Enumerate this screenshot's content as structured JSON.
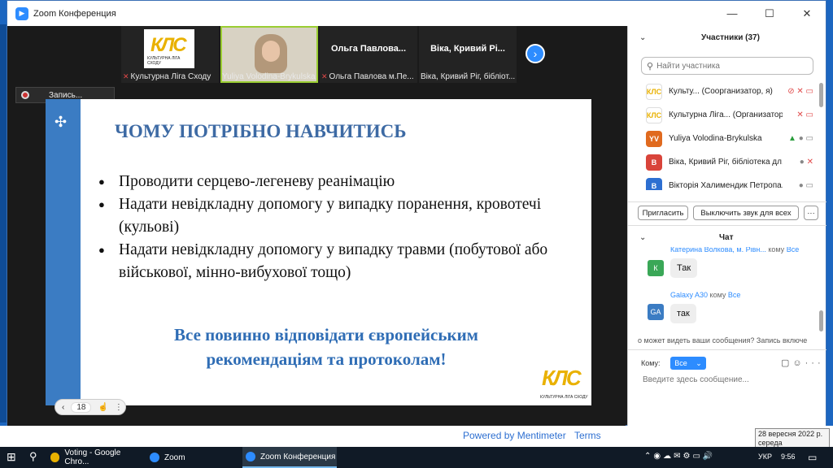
{
  "window": {
    "title": "Zoom Конференция",
    "minimize": "—",
    "maximize": "☐",
    "close": "✕"
  },
  "thumbnails": [
    {
      "label": "Культурна Ліга Сходу",
      "logo_text": "КЛС",
      "logo_sub": "КУЛЬТУРНА ЛІГА СХОДУ",
      "mic": "muted"
    },
    {
      "label": "Yuliya Volodina-Brykulska",
      "has_video": true
    },
    {
      "label": "Ольга Павлова м.Пе...",
      "big_name": "Ольга Павлова...",
      "mic": "muted"
    },
    {
      "label": "Віка, Кривий Ріг, бібліот...",
      "big_name": "Віка, Кривий Рі..."
    }
  ],
  "recording": {
    "label": "Запись..."
  },
  "slide": {
    "title": "ЧОМУ ПОТРІБНО НАВЧИТИСЬ",
    "bullets": [
      "Проводити серцево-легеневу реанімацію",
      "Надати невідкладну допомогу у випадку поранення, кровотечі (кульові)",
      "Надати невідкладну допомогу у випадку травми (побутової або військової, мінно-вибухової тощо)"
    ],
    "footer_line1": "Все повинно відповідати європейським",
    "footer_line2": "рекомендаціям та протоколам!",
    "logo_text": "КЛС",
    "logo_sub": "КУЛЬТУРНА ЛІГА СХОДУ",
    "page_number": "18"
  },
  "participants": {
    "title": "Участники (37)",
    "search_placeholder": "Найти участника",
    "rows": [
      {
        "name": "Культу... (Соорганизатор, я)",
        "avatar_text": "КЛС",
        "avatar_color": "#ffffff",
        "status": "muted"
      },
      {
        "name": "Культурна Ліга... (Организатор)",
        "avatar_text": "КЛС",
        "avatar_color": "#ffffff",
        "status": "muted"
      },
      {
        "name": "Yuliya Volodina-Brykulska",
        "avatar_text": "YV",
        "avatar_color": "#e06a1f",
        "status": "on"
      },
      {
        "name": "Віка, Кривий Ріг, бібліотека дл...",
        "avatar_text": "В",
        "avatar_color": "#d9443a",
        "status": "muted"
      },
      {
        "name": "Вікторія Халимендик Петропа...",
        "avatar_text": "В",
        "avatar_color": "#2d6fd1",
        "status": "on"
      }
    ],
    "invite_label": "Пригласить",
    "mute_all_label": "Выключить звук для всех",
    "more_label": "···"
  },
  "chat": {
    "title": "Чат",
    "messages": [
      {
        "sender": "Катерина Волкова, м. Рівн...",
        "to_word": "кому",
        "recipient": "Все",
        "avatar_text": "К",
        "avatar_color": "#3aa757",
        "text": "Так"
      },
      {
        "sender": "Galaxy A30",
        "to_word": "кому",
        "recipient": "Все",
        "avatar_text": "GA",
        "avatar_color": "#3b7cc3",
        "text": "так"
      }
    ],
    "notice": "о может видеть ваши сообщения? Запись включе",
    "to_label": "Кому:",
    "to_value": "Все",
    "input_placeholder": "Введите здесь сообщение..."
  },
  "below": {
    "powered": "Powered by Mentimeter",
    "terms": "Terms"
  },
  "tooltip": {
    "date": "28 вересня 2022 р.",
    "day": "середа"
  },
  "taskbar": {
    "items": [
      {
        "label": "Voting - Google Chro...",
        "color": "#e8b100"
      },
      {
        "label": "Zoom",
        "color": "#2d8cff"
      },
      {
        "label": "Zoom Конференция",
        "color": "#2d8cff"
      }
    ],
    "lang": "УКР",
    "time": "9:56"
  }
}
